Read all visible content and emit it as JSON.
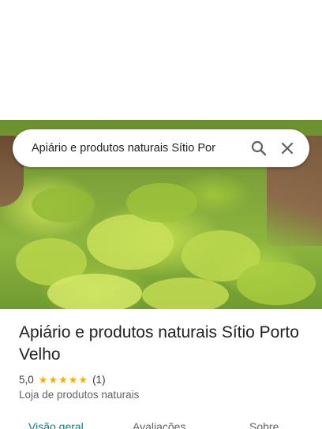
{
  "search": {
    "query": "Apiário e produtos naturais Sítio Por",
    "search_icon": "search-icon",
    "close_icon": "close-icon"
  },
  "place": {
    "name": "Apiário e produtos naturais Sítio Porto Velho",
    "rating": "5,0",
    "stars": 5,
    "review_count": "(1)",
    "category": "Loja de produtos naturais"
  },
  "tabs": [
    {
      "label": "Visão geral",
      "active": true
    },
    {
      "label": "Avaliações",
      "active": false
    },
    {
      "label": "Sobre",
      "active": false
    }
  ],
  "colors": {
    "accent": "#0b8080",
    "star": "#f6b100"
  }
}
